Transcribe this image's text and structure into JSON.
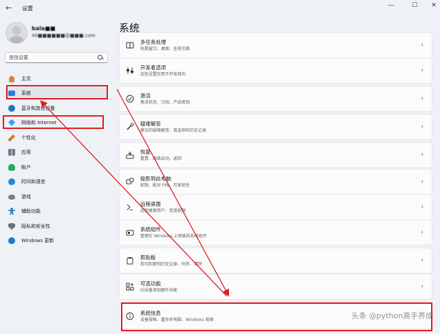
{
  "window": {
    "title": "设置",
    "controls": [
      "minimize",
      "maximize",
      "close"
    ]
  },
  "profile": {
    "name": "bala■■",
    "email": "40■■■■■■@■■■.com"
  },
  "search": {
    "placeholder": "查找设置"
  },
  "sidebar": {
    "items": [
      {
        "label": "主页",
        "icon": "home-icon",
        "color": "#e0802e"
      },
      {
        "label": "系统",
        "icon": "system-icon",
        "color": "#2a7fd4",
        "selected": true
      },
      {
        "label": "蓝牙和其他设备",
        "icon": "bluetooth-icon",
        "color": "#1e73c9"
      },
      {
        "label": "网络和 Internet",
        "icon": "network-icon",
        "color": "#3aa0e0"
      },
      {
        "label": "个性化",
        "icon": "personalization-icon",
        "color": "#d07a2a"
      },
      {
        "label": "应用",
        "icon": "apps-icon",
        "color": "#6e7a8a"
      },
      {
        "label": "帐户",
        "icon": "accounts-icon",
        "color": "#2aa86a"
      },
      {
        "label": "时间和语言",
        "icon": "time-language-icon",
        "color": "#2a86c8"
      },
      {
        "label": "游戏",
        "icon": "gaming-icon",
        "color": "#7a7f86"
      },
      {
        "label": "辅助功能",
        "icon": "accessibility-icon",
        "color": "#1f6fc2"
      },
      {
        "label": "隐私和安全性",
        "icon": "privacy-shield-icon",
        "color": "#6b737c"
      },
      {
        "label": "Windows 更新",
        "icon": "windows-update-icon",
        "color": "#1f7ad0"
      }
    ]
  },
  "main": {
    "title": "系统",
    "cards": [
      {
        "title": "多任务处理",
        "subtitle": "贴靠窗口、桌面、任务切换",
        "icon": "multitasking-icon"
      },
      {
        "title": "开发者选项",
        "subtitle": "这些设置仅用于开发目的",
        "icon": "developer-tools-icon"
      },
      {
        "title": "激活",
        "subtitle": "激活状态、订阅、产品密钥",
        "icon": "activation-check-icon"
      },
      {
        "title": "疑难解答",
        "subtitle": "建议的疑难解答、首选项和历史记录",
        "icon": "troubleshoot-wrench-icon"
      },
      {
        "title": "恢复",
        "subtitle": "重置、高级启动、返回",
        "icon": "recovery-icon"
      },
      {
        "title": "投影到此电脑",
        "subtitle": "权限、配对 PIN、可发现性",
        "icon": "project-to-pc-icon"
      },
      {
        "title": "远程桌面",
        "subtitle": "远程桌面用户、连接权限",
        "icon": "remote-desktop-icon"
      },
      {
        "title": "系统组件",
        "subtitle": "管理在 Windows 上预装的系统组件",
        "icon": "system-components-icon"
      },
      {
        "title": "剪贴板",
        "subtitle": "剪切和复制历史记录、同步、清除",
        "icon": "clipboard-icon"
      },
      {
        "title": "可选功能",
        "subtitle": "向设备添加额外功能",
        "icon": "optional-features-icon"
      },
      {
        "title": "系统信息",
        "subtitle": "设备规格、重命名电脑、Windows 规格",
        "icon": "info-icon"
      }
    ]
  },
  "watermark": "头条 @python高手养成",
  "annotation_color": "#e0191d"
}
